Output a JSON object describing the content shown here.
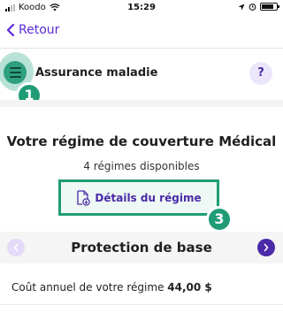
{
  "status_bar": {
    "carrier": "Koodo",
    "time": "15:29"
  },
  "nav": {
    "back_label": "Retour"
  },
  "header": {
    "title": "Assurance maladie",
    "help_label": "?"
  },
  "callouts": {
    "menu_badge": "1",
    "details_badge": "3"
  },
  "main": {
    "title": "Votre régime de couverture Médical",
    "count_text": "4 régimes disponibles",
    "details_button_label": "Détails du régime"
  },
  "plan_selector": {
    "current_plan": "Protection de base"
  },
  "cost": {
    "label": "Coût annuel de votre régime",
    "value": "44,00 $"
  },
  "colors": {
    "accent_purple": "#4a2aa8",
    "highlight_green": "#1f9c76",
    "menu_halo": "#b9e2d6"
  },
  "icons": [
    "signal-icon",
    "wifi-icon",
    "location-icon",
    "alarm-icon",
    "battery-icon",
    "chevron-left-icon",
    "menu-icon",
    "help-icon",
    "document-download-icon",
    "chevron-right-icon"
  ]
}
